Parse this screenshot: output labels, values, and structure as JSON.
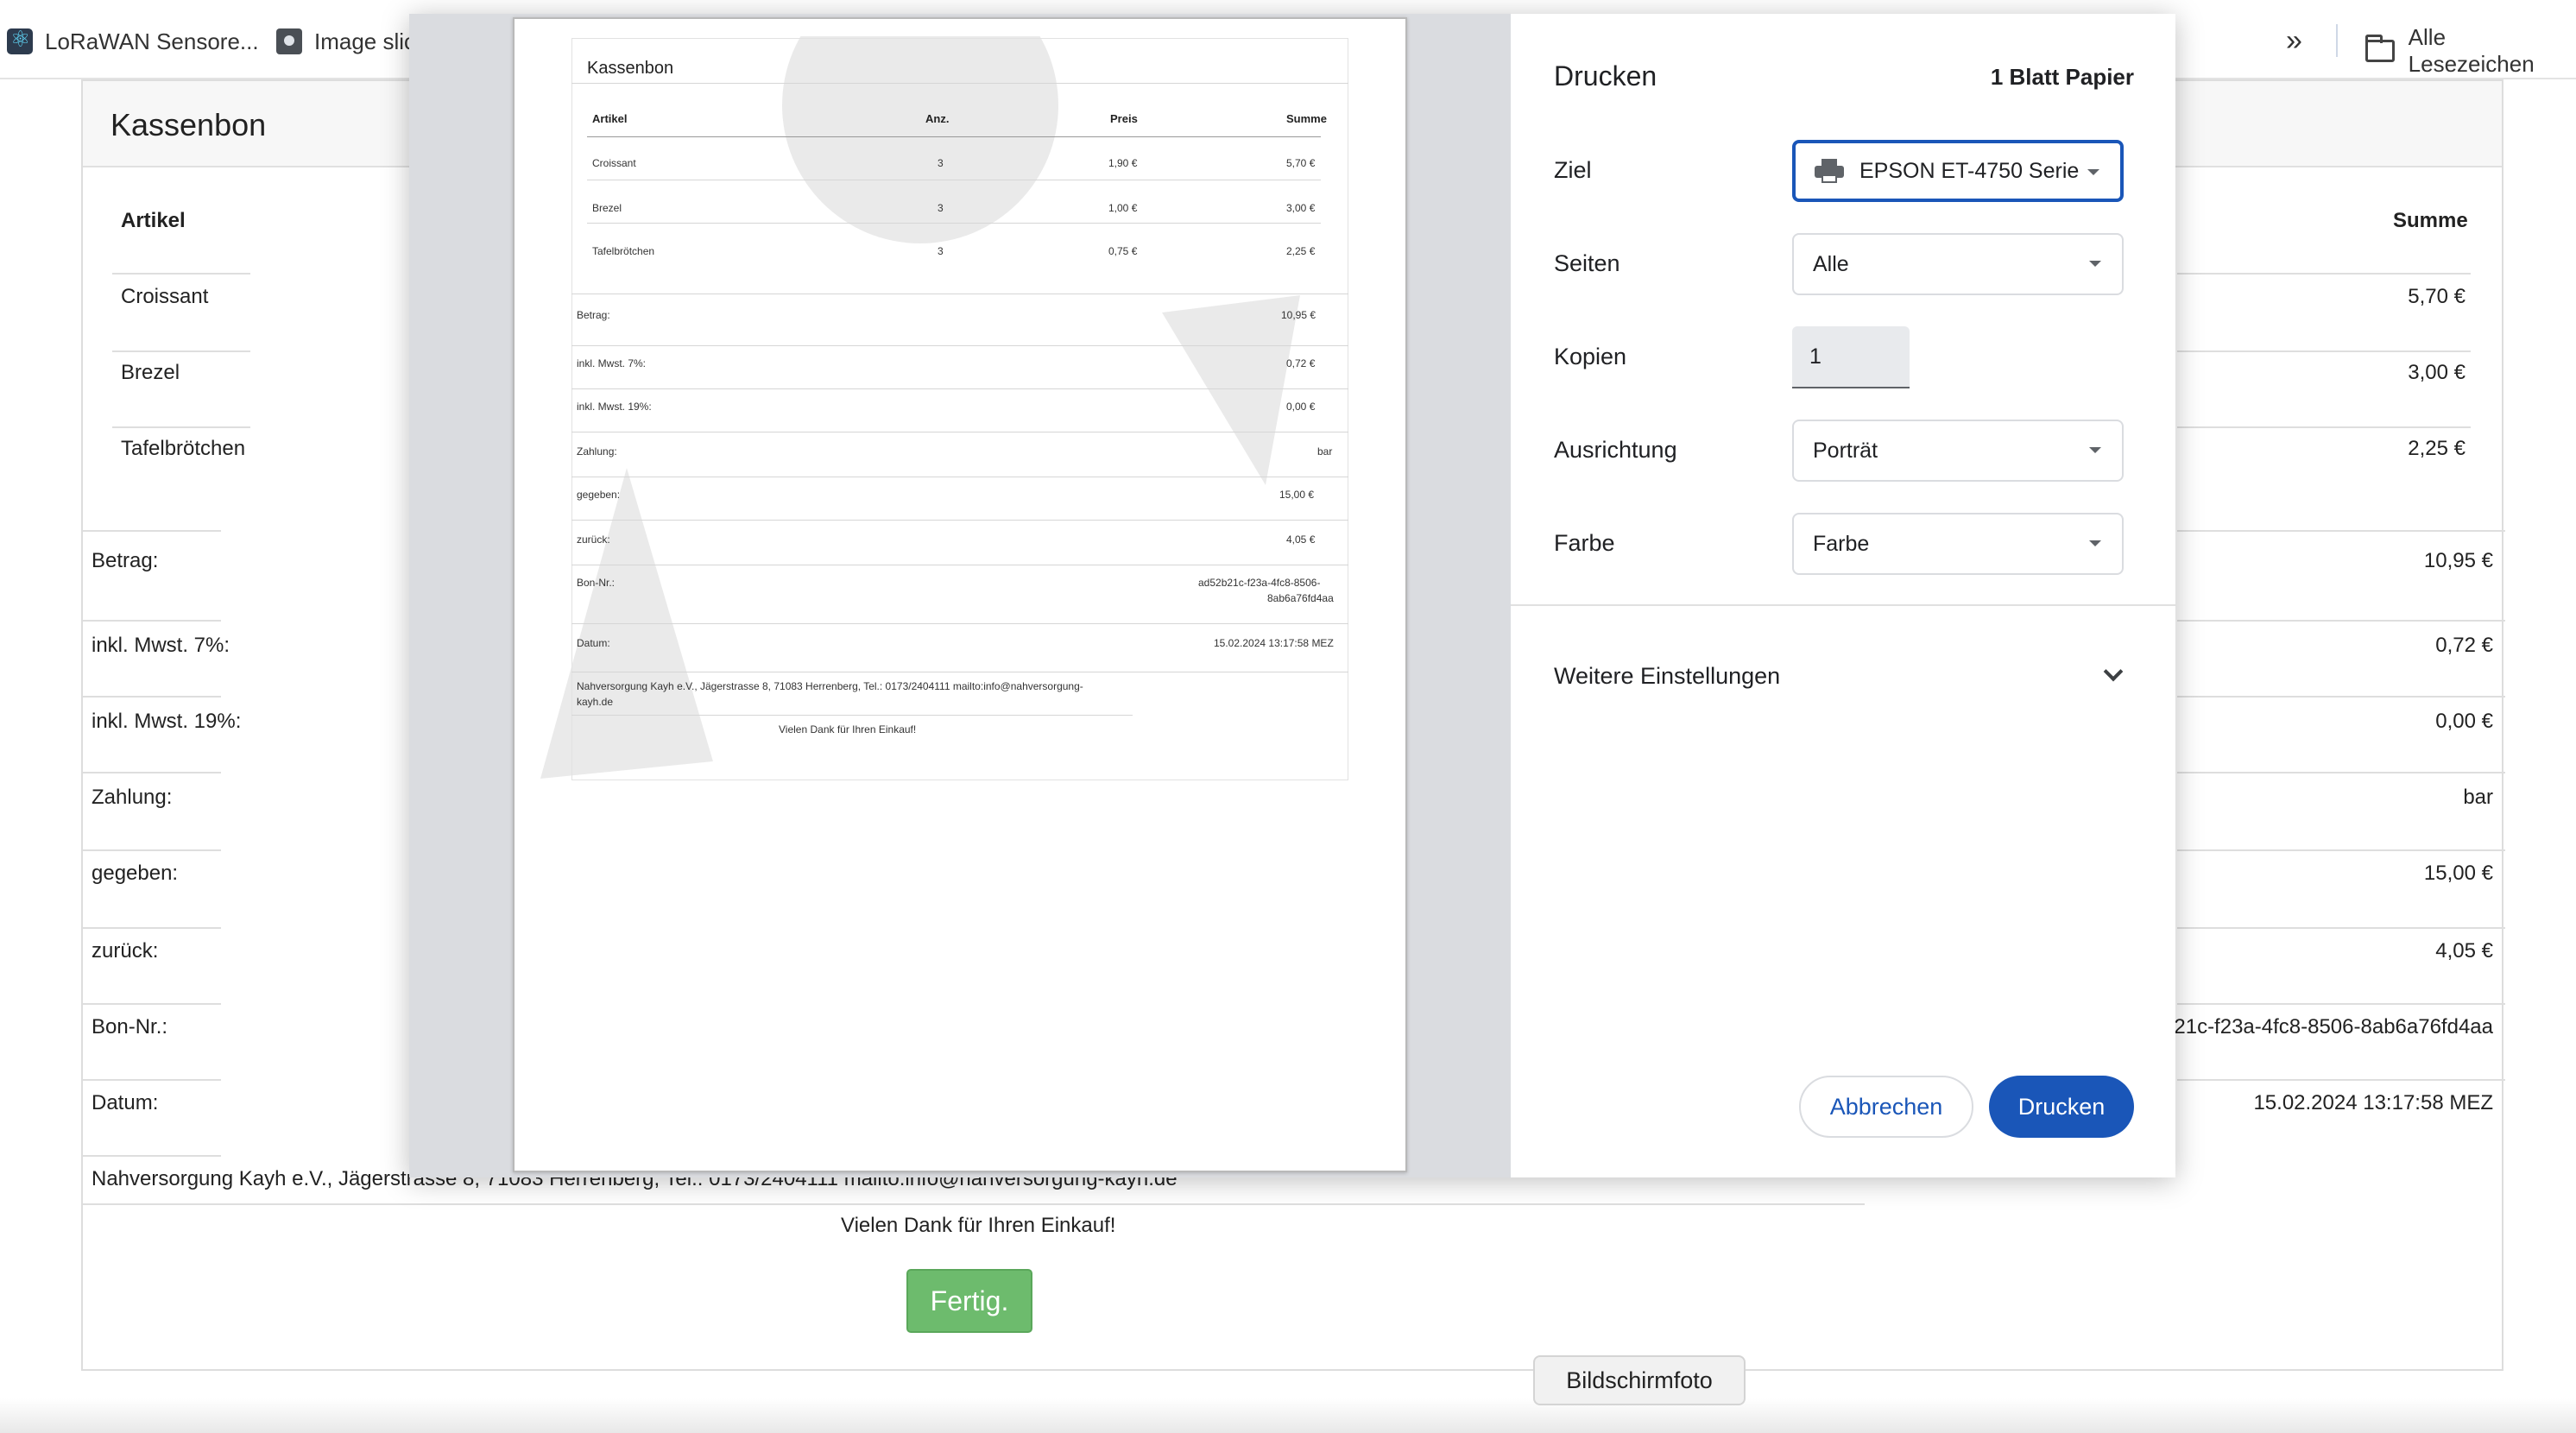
{
  "bookmarks": {
    "items": [
      {
        "label": "LoRaWAN Sensore...",
        "icon": "react-icon"
      },
      {
        "label": "Image slic",
        "icon": "camera-icon"
      }
    ],
    "more_label": "»",
    "folder_label": "Alle Lesezeichen"
  },
  "receipt": {
    "title": "Kassenbon",
    "columns": [
      "Artikel",
      "Anz.",
      "Preis",
      "Summe"
    ],
    "rows": [
      {
        "artikel": "Croissant",
        "anz": "3",
        "preis": "1,90 €",
        "summe": "5,70 €"
      },
      {
        "artikel": "Brezel",
        "anz": "3",
        "preis": "1,00 €",
        "summe": "3,00 €"
      },
      {
        "artikel": "Tafelbrötchen",
        "anz": "3",
        "preis": "0,75 €",
        "summe": "2,25 €"
      }
    ],
    "totals": [
      {
        "label": "Betrag:",
        "value": "10,95 €"
      },
      {
        "label": "inkl. Mwst. 7%:",
        "value": "0,72 €"
      },
      {
        "label": "inkl. Mwst. 19%:",
        "value": "0,00 €"
      },
      {
        "label": "Zahlung:",
        "value": "bar"
      },
      {
        "label": "gegeben:",
        "value": "15,00 €"
      },
      {
        "label": "zurück:",
        "value": "4,05 €"
      },
      {
        "label": "Bon-Nr.:",
        "value": "ad52b21c-f23a-4fc8-8506-8ab6a76fd4aa"
      },
      {
        "label": "Datum:",
        "value": "15.02.2024 13:17:58 MEZ"
      }
    ],
    "bon_nr_visible": "2b21c-f23a-4fc8-8506-8ab6a76fd4aa",
    "bon_nr_line1": "ad52b21c-f23a-4fc8-8506-",
    "bon_nr_line2": "8ab6a76fd4aa",
    "footer_address": "Nahversorgung Kayh e.V., Jägerstrasse 8, 71083 Herrenberg, Tel.: 0173/2404111 mailto:info@nahversorgung-kayh.de",
    "footer_address_bg": "Nahversorgung Kayh e.V., Jägerstrasse 8, 71083 Herrenberg, Tel.: 0173/2404111 mailto:info@nahversorgung-kayh.de",
    "footer_line1": "Nahversorgung Kayh e.V., Jägerstrasse 8, 71083 Herrenberg, Tel.: 0173/2404111 mailto:info@nahversorgung-",
    "footer_line2": "kayh.de",
    "thanks": "Vielen Dank für Ihren Einkauf!",
    "done_button": "Fertig."
  },
  "print_dialog": {
    "title": "Drucken",
    "sheets": "1 Blatt Papier",
    "fields": {
      "ziel_label": "Ziel",
      "ziel_value": "EPSON ET-4750 Serie",
      "seiten_label": "Seiten",
      "seiten_value": "Alle",
      "kopien_label": "Kopien",
      "kopien_value": "1",
      "ausrichtung_label": "Ausrichtung",
      "ausrichtung_value": "Porträt",
      "farbe_label": "Farbe",
      "farbe_value": "Farbe"
    },
    "more_settings": "Weitere Einstellungen",
    "cancel_button": "Abbrechen",
    "print_button": "Drucken",
    "accent_color": "#1a56b8"
  },
  "tooltip": "Bildschirmfoto"
}
